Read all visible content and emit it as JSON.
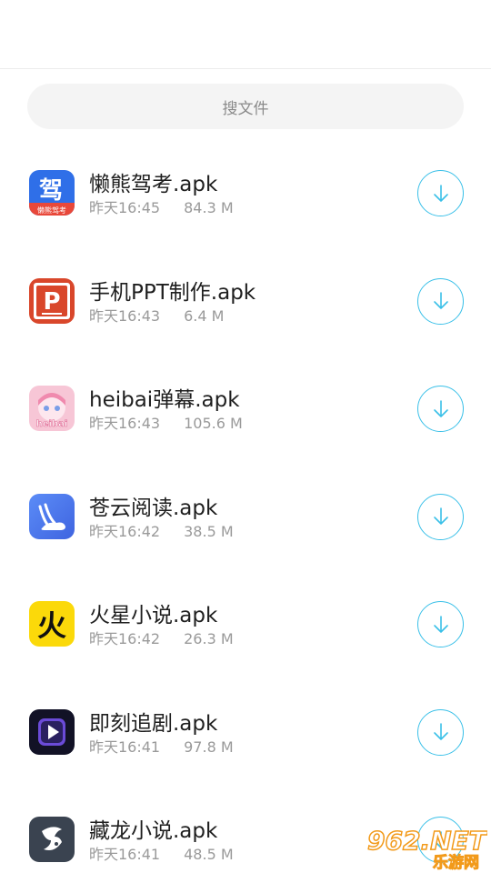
{
  "search": {
    "placeholder": "搜文件"
  },
  "files": [
    {
      "name": "懒熊驾考.apk",
      "time": "昨天16:45",
      "size": "84.3 M",
      "icon": "lanxiong-jiakao-app-icon"
    },
    {
      "name": "手机PPT制作.apk",
      "time": "昨天16:43",
      "size": "6.4 M",
      "icon": "ppt-app-icon"
    },
    {
      "name": "heibai弹幕.apk",
      "time": "昨天16:43",
      "size": "105.6 M",
      "icon": "heibai-danmu-app-icon"
    },
    {
      "name": "苍云阅读.apk",
      "time": "昨天16:42",
      "size": "38.5 M",
      "icon": "cangyun-yuedu-app-icon"
    },
    {
      "name": "火星小说.apk",
      "time": "昨天16:42",
      "size": "26.3 M",
      "icon": "huoxing-xiaoshuo-app-icon"
    },
    {
      "name": "即刻追剧.apk",
      "time": "昨天16:41",
      "size": "97.8 M",
      "icon": "jike-zhuiju-app-icon"
    },
    {
      "name": "藏龙小说.apk",
      "time": "昨天16:41",
      "size": "48.5 M",
      "icon": "canglong-xiaoshuo-app-icon"
    }
  ],
  "icon_text": {
    "jiakao_big": "驾",
    "jiakao_small": "懒熊驾考",
    "ppt": "P",
    "heibai": "heibai",
    "huoxing": "火"
  },
  "watermark": {
    "brand": "962.NET",
    "site": "乐游网"
  },
  "colors": {
    "accent": "#3ac0e8",
    "name_text": "#1f1f1f",
    "meta_text": "#9a9a9a",
    "search_bg": "#f4f4f4"
  }
}
